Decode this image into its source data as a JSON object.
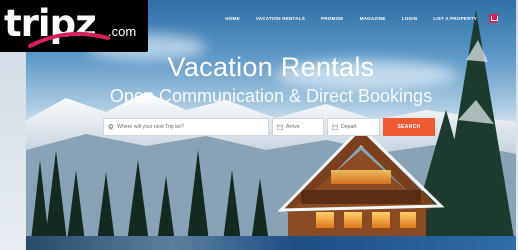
{
  "brand": {
    "logo_main": "tripz",
    "logo_suffix": ".com"
  },
  "nav": {
    "items": [
      {
        "label": "HOME"
      },
      {
        "label": "VACATION RENTALS"
      },
      {
        "label": "PROMISE"
      },
      {
        "label": "MAGAZINE"
      },
      {
        "label": "LOGIN"
      },
      {
        "label": "LIST A PROPERTY"
      }
    ]
  },
  "hero": {
    "title": "Vacation Rentals",
    "subtitle": "Open Communication & Direct Bookings"
  },
  "search": {
    "where_placeholder": "Where will your next Trip be?",
    "arrive_placeholder": "Arrive",
    "depart_placeholder": "Depart",
    "button_label": "SEARCH"
  },
  "colors": {
    "accent": "#ef5a35",
    "brand_pink": "#d6205a",
    "logo_bg": "#000000"
  },
  "icons": [
    "map-pin-icon",
    "calendar-icon",
    "menu-icon"
  ]
}
